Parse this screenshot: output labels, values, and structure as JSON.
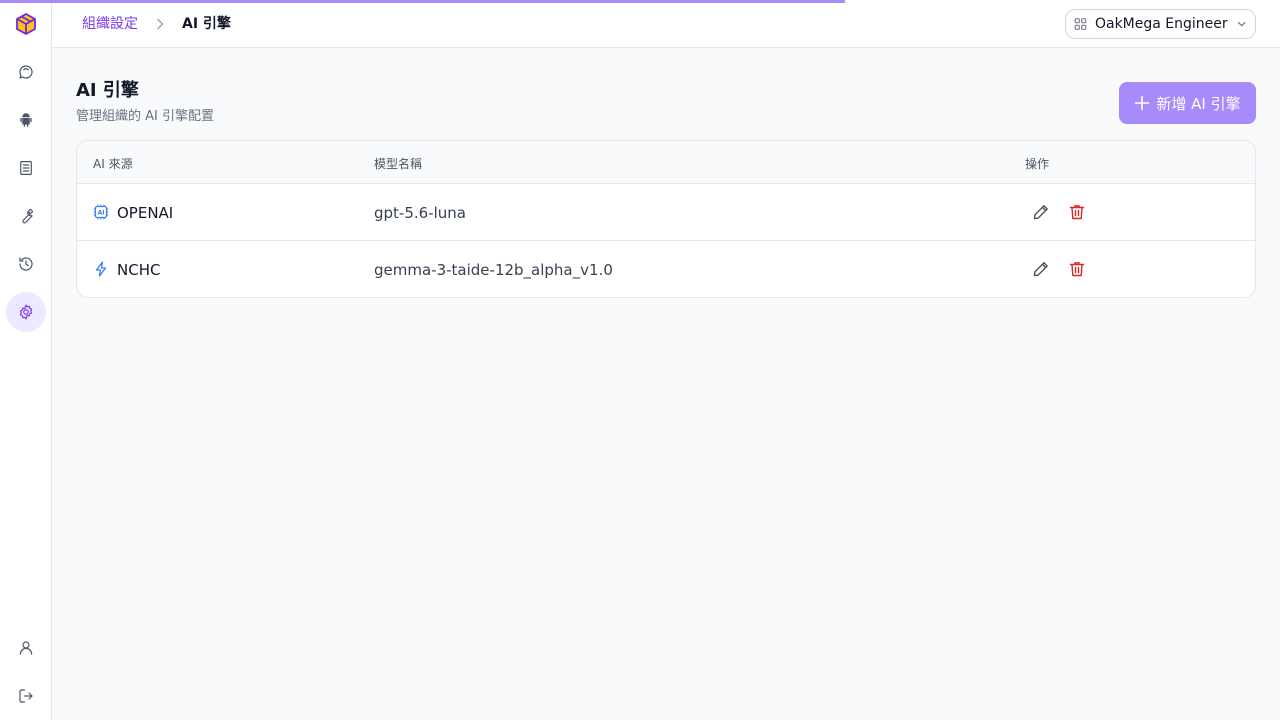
{
  "breadcrumb": {
    "parent": "組織設定",
    "current": "AI 引擎"
  },
  "org_selector": {
    "value": "OakMega Engineer"
  },
  "page": {
    "title": "AI 引擎",
    "subtitle": "管理組織的 AI 引擎配置",
    "add_button": "新增 AI 引擎"
  },
  "table": {
    "headers": [
      "AI 來源",
      "模型名稱",
      "操作"
    ],
    "rows": [
      {
        "source": "OPENAI",
        "source_icon": "ai-chip-icon",
        "model": "gpt-5.6-luna"
      },
      {
        "source": "NCHC",
        "source_icon": "lightning-icon",
        "model": "gemma-3-taide-12b_alpha_v1.0"
      }
    ]
  },
  "loading_progress": 0.66,
  "colors": {
    "accent": "#7c3aed",
    "button": "#a78bfa",
    "danger": "#dc2626",
    "icon_blue": "#3b82f6"
  }
}
